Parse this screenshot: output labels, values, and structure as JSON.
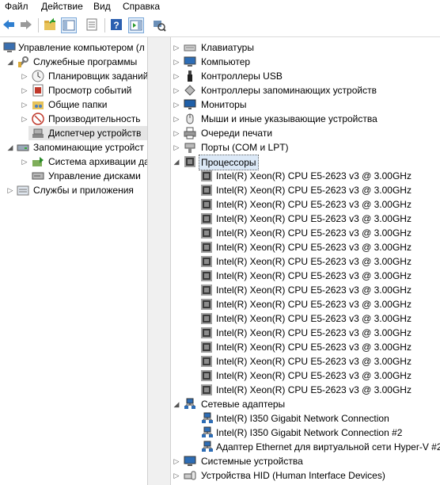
{
  "menu": {
    "file": "Файл",
    "action": "Действие",
    "view": "Вид",
    "help": "Справка"
  },
  "toolbar": {
    "buttons": [
      "back-icon",
      "forward-icon",
      "up-folder-icon",
      "show-hide-tree-icon",
      "properties-icon",
      "help-icon",
      "show-action-pane-icon",
      "scan-hardware-icon"
    ]
  },
  "left_tree": {
    "root": "Управление компьютером (л",
    "utilities": "Служебные программы",
    "scheduler": "Планировщик заданий",
    "event_viewer": "Просмотр событий",
    "shared_folders": "Общие папки",
    "performance": "Производительность",
    "device_manager": "Диспетчер устройств",
    "storage": "Запоминающие устройст",
    "backup": "Система архивации да",
    "disk_mgmt": "Управление дисками",
    "services_apps": "Службы и приложения"
  },
  "devices": {
    "keyboards": "Клавиатуры",
    "computer": "Компьютер",
    "usb": "Контроллеры USB",
    "storage_ctrl": "Контроллеры запоминающих устройств",
    "monitors": "Мониторы",
    "mice": "Мыши и иные указывающие устройства",
    "print_queues": "Очереди печати",
    "ports": "Порты (COM и LPT)",
    "processors": "Процессоры",
    "cpus": [
      "Intel(R) Xeon(R) CPU E5-2623 v3 @ 3.00GHz",
      "Intel(R) Xeon(R) CPU E5-2623 v3 @ 3.00GHz",
      "Intel(R) Xeon(R) CPU E5-2623 v3 @ 3.00GHz",
      "Intel(R) Xeon(R) CPU E5-2623 v3 @ 3.00GHz",
      "Intel(R) Xeon(R) CPU E5-2623 v3 @ 3.00GHz",
      "Intel(R) Xeon(R) CPU E5-2623 v3 @ 3.00GHz",
      "Intel(R) Xeon(R) CPU E5-2623 v3 @ 3.00GHz",
      "Intel(R) Xeon(R) CPU E5-2623 v3 @ 3.00GHz",
      "Intel(R) Xeon(R) CPU E5-2623 v3 @ 3.00GHz",
      "Intel(R) Xeon(R) CPU E5-2623 v3 @ 3.00GHz",
      "Intel(R) Xeon(R) CPU E5-2623 v3 @ 3.00GHz",
      "Intel(R) Xeon(R) CPU E5-2623 v3 @ 3.00GHz",
      "Intel(R) Xeon(R) CPU E5-2623 v3 @ 3.00GHz",
      "Intel(R) Xeon(R) CPU E5-2623 v3 @ 3.00GHz",
      "Intel(R) Xeon(R) CPU E5-2623 v3 @ 3.00GHz",
      "Intel(R) Xeon(R) CPU E5-2623 v3 @ 3.00GHz"
    ],
    "net_adapters": "Сетевые адаптеры",
    "nics": [
      "Intel(R) I350 Gigabit Network Connection",
      "Intel(R) I350 Gigabit Network Connection #2",
      "Адаптер Ethernet для виртуальной сети Hyper-V #2"
    ],
    "system_devices": "Системные устройства",
    "hid": "Устройства HID (Human Interface Devices)"
  }
}
